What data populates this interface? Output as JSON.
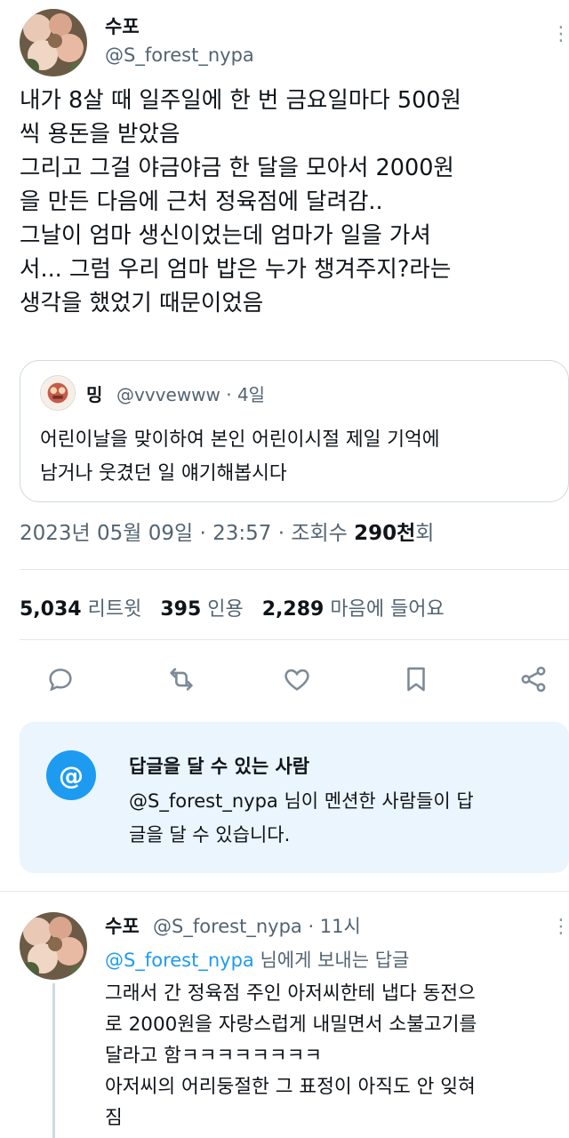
{
  "main_tweet": {
    "display_name": "수포",
    "handle": "@S_forest_nypa",
    "text": "내가 8살 때 일주일에 한 번 금요일마다 500원\n씩 용돈을 받았음\n그리고 그걸 야금야금 한 달을 모아서 2000원\n을 만든 다음에 근처 정육점에 달려감..\n그날이 엄마 생신이었는데 엄마가 일을 가셔\n서... 그럼 우리 엄마 밥은 누가 챙겨주지?라는\n생각을 했었기 때문이었음",
    "more_icon": "more-dots-icon"
  },
  "quote": {
    "display_name": "밍",
    "handle_time": "@vvvewww · 4일",
    "text": "어린이날을 맞이하여 본인 어린이시절 제일 기억에\n남거나 웃겼던 일 얘기해봅시다"
  },
  "meta": {
    "datetime": "2023년 05월 09일 · 23:57 · 조회수 ",
    "views": "290천",
    "views_suffix": "회"
  },
  "stats": {
    "retweets_count": "5,034",
    "retweets_label": "리트윗",
    "quotes_count": "395",
    "quotes_label": "인용",
    "likes_count": "2,289",
    "likes_label": "마음에 들어요"
  },
  "actions": [
    {
      "icon": "reply-icon"
    },
    {
      "icon": "retweet-icon"
    },
    {
      "icon": "like-icon"
    },
    {
      "icon": "bookmark-icon"
    },
    {
      "icon": "share-icon"
    }
  ],
  "reply_notice": {
    "icon_glyph": "@",
    "title": "답글을 달 수 있는 사람",
    "text": "@S_forest_nypa 님이 멘션한 사람들이 답\n글을 달 수 있습니다."
  },
  "reply_tweet": {
    "display_name": "수포",
    "handle_time": "@S_forest_nypa · 11시",
    "replying_mention": "@S_forest_nypa",
    "replying_suffix": " 님에게 보내는 답글",
    "text": "그래서 간 정육점 주인 아저씨한테 냅다 동전으\n로 2000원을 자랑스럽게 내밀면서 소불고기를\n달라고 함ㅋㅋㅋㅋㅋㅋㅋㅋ\n아저씨의 어리둥절한 그 표정이 아직도 안 잊혀\n짐"
  },
  "colors": {
    "accent": "#1d9bf0",
    "text": "#0f1419",
    "secondary": "#536471",
    "notice_bg": "#eaf5fd"
  }
}
